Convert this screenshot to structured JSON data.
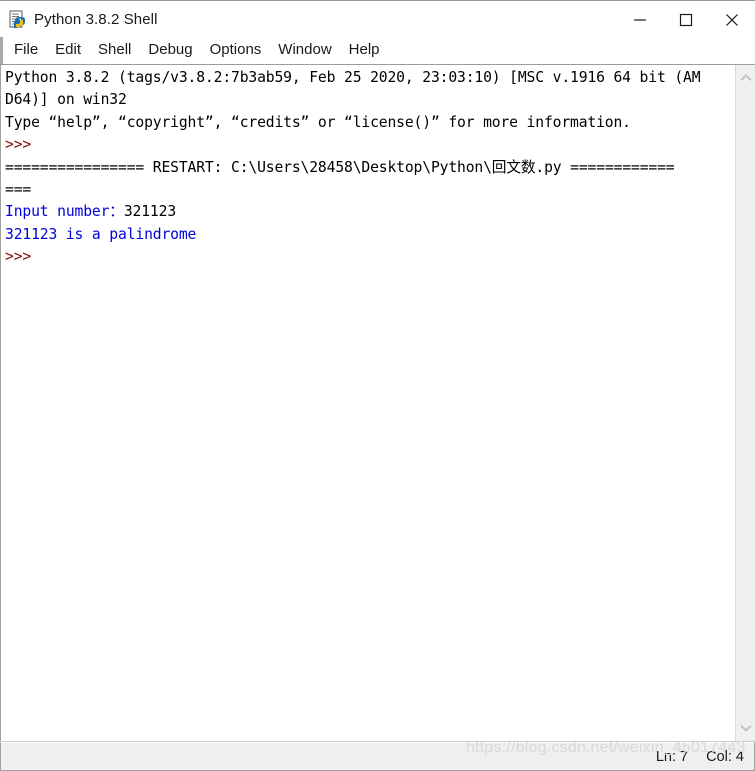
{
  "window": {
    "title": "Python 3.8.2 Shell",
    "icon": "python-idle-document-icon",
    "controls": {
      "minimize": "minimize-icon",
      "maximize": "maximize-icon",
      "close": "close-icon"
    }
  },
  "menu": {
    "items": [
      {
        "label": "File"
      },
      {
        "label": "Edit"
      },
      {
        "label": "Shell"
      },
      {
        "label": "Debug"
      },
      {
        "label": "Options"
      },
      {
        "label": "Window"
      },
      {
        "label": "Help"
      }
    ]
  },
  "console": {
    "lines": [
      {
        "segments": [
          {
            "text": "Python 3.8.2 (tags/v3.8.2:7b3ab59, Feb 25 2020, 23:03:10) [MSC v.1916 64 bit (AM",
            "color": "black"
          }
        ]
      },
      {
        "segments": [
          {
            "text": "D64)] on win32",
            "color": "black"
          }
        ]
      },
      {
        "segments": [
          {
            "text": "Type “help”, “copyright”, “credits” or “license()” for more information.",
            "color": "black"
          }
        ]
      },
      {
        "segments": [
          {
            "text": ">>> ",
            "color": "maroon"
          }
        ]
      },
      {
        "segments": [
          {
            "text": "================ RESTART: C:\\Users\\28458\\Desktop\\Python\\回文数.py ============",
            "color": "black"
          }
        ]
      },
      {
        "segments": [
          {
            "text": "===",
            "color": "black"
          }
        ]
      },
      {
        "segments": [
          {
            "text": "Input number：",
            "color": "blue"
          },
          {
            "text": "321123",
            "color": "black"
          }
        ]
      },
      {
        "segments": [
          {
            "text": "321123 is a palindrome",
            "color": "blue"
          }
        ]
      },
      {
        "segments": [
          {
            "text": ">>> ",
            "color": "maroon"
          }
        ]
      }
    ]
  },
  "scrollbar": {
    "up_arrow": "chevron-up-icon",
    "down_arrow": "chevron-down-icon"
  },
  "status_bar": {
    "line_label": "Ln: 7",
    "col_label": "Col: 4"
  },
  "watermark": {
    "text": "https://blog.csdn.net/weixin_45017443"
  },
  "colors": {
    "stdout_blue": "#0000dd",
    "prompt_maroon": "#7b0c0c",
    "text_black": "#000000",
    "window_bg": "#ffffff",
    "status_bg": "#efefef"
  }
}
